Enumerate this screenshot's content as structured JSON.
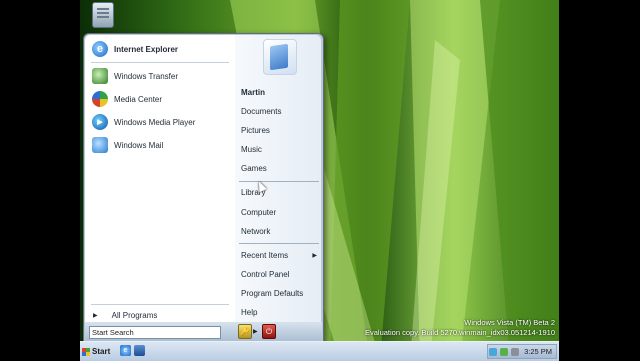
{
  "desktop": {
    "watermark_line1": "Windows Vista (TM) Beta 2",
    "watermark_line2": "Evaluation copy. Build 5270.winmain_idx03.051214-1910"
  },
  "start_menu": {
    "pinned": [
      {
        "label": "Internet Explorer",
        "icon": "internet-explorer-icon"
      }
    ],
    "recent": [
      {
        "label": "Windows Transfer",
        "icon": "windows-transfer-icon"
      },
      {
        "label": "Media Center",
        "icon": "media-center-icon"
      },
      {
        "label": "Windows Media Player",
        "icon": "media-player-icon"
      },
      {
        "label": "Windows Mail",
        "icon": "windows-mail-icon"
      }
    ],
    "all_programs": "All Programs",
    "search_placeholder": "Start Search",
    "right_items": [
      "Martin",
      "Documents",
      "Pictures",
      "Music",
      "Games",
      "Library",
      "Computer",
      "Network",
      "Recent Items",
      "Control Panel",
      "Program Defaults",
      "Help"
    ]
  },
  "taskbar": {
    "start_label": "Start",
    "clock": "3:25 PM"
  },
  "colors": {
    "menu_left_bg": "#ffffff",
    "menu_frame": "#b9c7d6",
    "taskbar": "#c9d8ea"
  }
}
